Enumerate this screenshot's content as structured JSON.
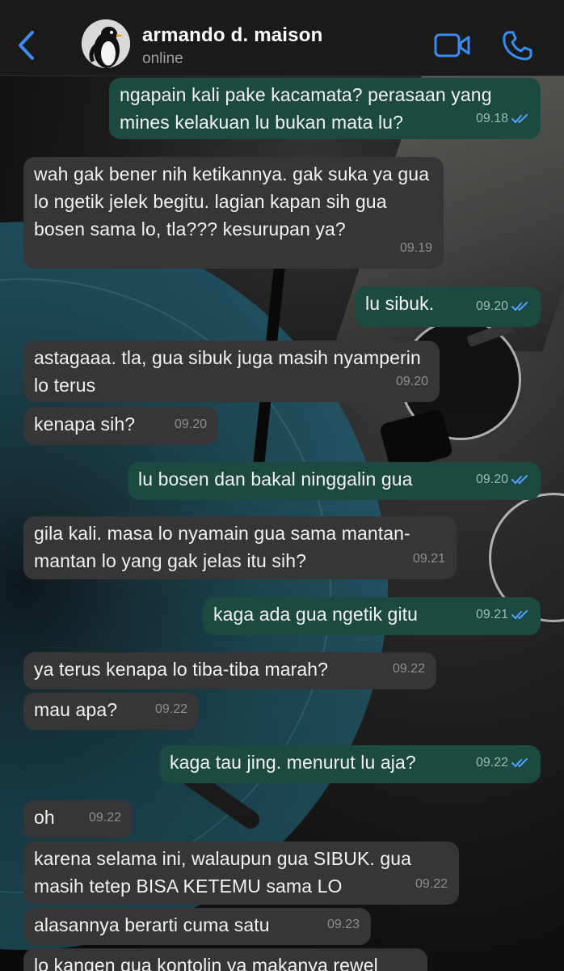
{
  "header": {
    "back_icon": "chevron-left-icon",
    "contact_name": "armando d. maison",
    "status": "online",
    "video_icon": "video-camera-icon",
    "call_icon": "phone-icon",
    "accent_color": "#3a8cf0"
  },
  "colors": {
    "incoming_bubble": "#363638",
    "outgoing_bubble": "#1d4a40",
    "read_tick": "#4fa3ff"
  },
  "messages": [
    {
      "dir": "out",
      "text": "ngapain kali pake kacamata? perasaan yang mines kelakuan lu bukan mata lu?",
      "time": "09.18",
      "read": true
    },
    {
      "dir": "in",
      "text": "wah gak bener nih ketikannya. gak suka ya gua lo ngetik jelek begitu. lagian kapan sih gua bosen sama lo, tla??? kesurupan ya?",
      "time": "09.19"
    },
    {
      "dir": "out",
      "text": "lu sibuk.",
      "time": "09.20",
      "read": true
    },
    {
      "dir": "in",
      "text": "astagaaa. tla, gua sibuk juga masih nyamperin lo terus",
      "time": "09.20"
    },
    {
      "dir": "in",
      "text": "kenapa sih?",
      "time": "09.20"
    },
    {
      "dir": "out",
      "text": "lu bosen dan bakal ninggalin gua",
      "time": "09.20",
      "read": true
    },
    {
      "dir": "in",
      "text": "gila kali. masa lo nyamain gua sama mantan-mantan lo yang gak jelas itu sih?",
      "time": "09.21"
    },
    {
      "dir": "out",
      "text": "kaga ada gua ngetik gitu",
      "time": "09.21",
      "read": true
    },
    {
      "dir": "in",
      "text": "ya terus kenapa lo tiba-tiba marah?",
      "time": "09.22"
    },
    {
      "dir": "in",
      "text": "mau apa?",
      "time": "09.22"
    },
    {
      "dir": "out",
      "text": "kaga tau jing. menurut lu aja?",
      "time": "09.22",
      "read": true
    },
    {
      "dir": "in",
      "text": "oh",
      "time": "09.22"
    },
    {
      "dir": "in",
      "text": "karena selama ini, walaupun gua SIBUK. gua masih tetep BISA KETEMU sama LO",
      "time": "09.22"
    },
    {
      "dir": "in",
      "text": "alasannya berarti cuma satu",
      "time": "09.23"
    },
    {
      "dir": "in",
      "text": "lo kangen gua kontolin ya makanya rewel",
      "time": ""
    }
  ]
}
